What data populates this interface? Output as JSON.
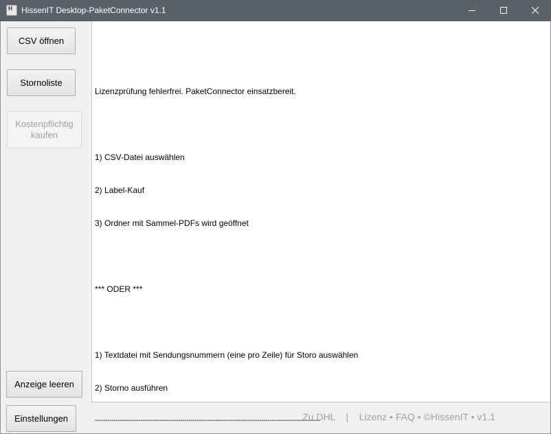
{
  "window": {
    "title": "HissenIT Desktop-PaketConnector v1.1"
  },
  "sidebar": {
    "csv_open": "CSV öffnen",
    "storno_list": "Stornoliste",
    "buy_line1": "Kostenpflichtig",
    "buy_line2": "kaufen",
    "clear_display": "Anzeige leeren",
    "settings": "Einstellungen"
  },
  "log": {
    "lines": [
      "Lizenzprüfung fehlerfrei. PaketConnector einsatzbereit.",
      "",
      "1) CSV-Datei auswählen",
      "2) Label-Kauf",
      "3) Ordner mit Sammel-PDFs wird geöffnet",
      "",
      "*** ODER ***",
      "",
      "1) Textdatei mit Sendungsnummern (eine pro Zeile) für Storo auswählen",
      "2) Storno ausführen",
      "------------------------------------------------------------------------------------------------------------"
    ]
  },
  "footer": {
    "dhl": "Zu DHL",
    "sep": "|",
    "license": "Lizenz",
    "dot": "•",
    "faq": "FAQ",
    "copyright": "©HissenIT",
    "version": "v1.1"
  }
}
